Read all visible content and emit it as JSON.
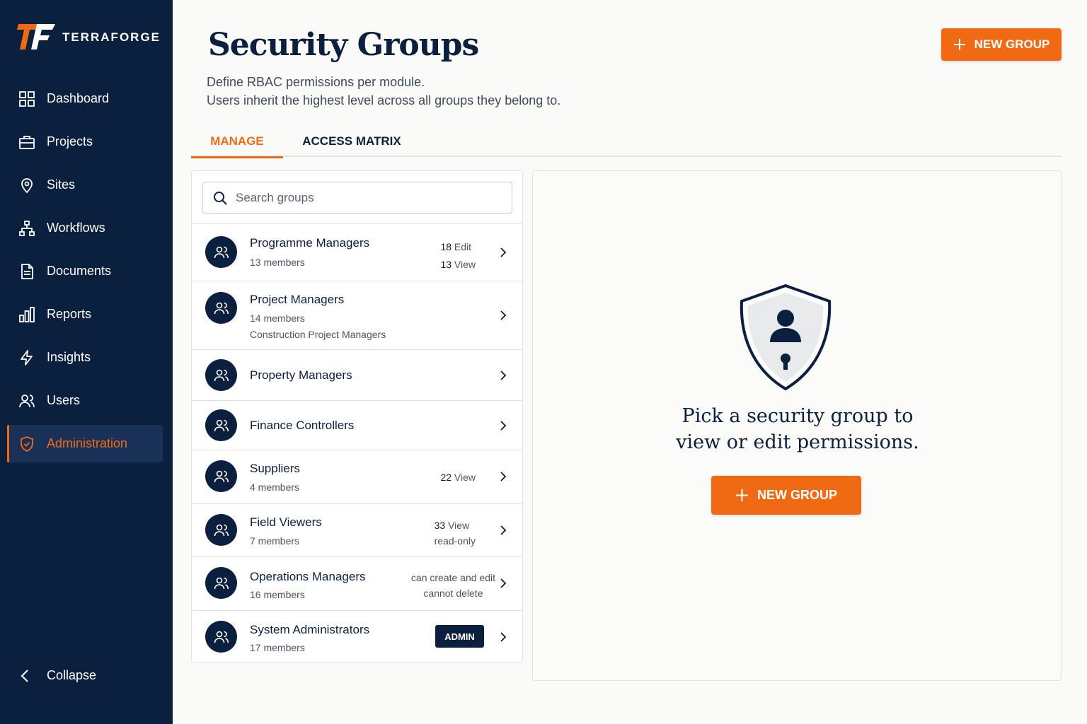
{
  "brand": {
    "name": "TERRAFORGE"
  },
  "sidebar": {
    "items": [
      {
        "label": "Dashboard",
        "icon": "dashboard-icon"
      },
      {
        "label": "Projects",
        "icon": "briefcase-icon"
      },
      {
        "label": "Sites",
        "icon": "map-pin-icon"
      },
      {
        "label": "Workflows",
        "icon": "workflow-icon"
      },
      {
        "label": "Documents",
        "icon": "document-icon"
      },
      {
        "label": "Reports",
        "icon": "bar-chart-icon"
      },
      {
        "label": "Insights",
        "icon": "lightning-icon"
      },
      {
        "label": "Users",
        "icon": "users-icon"
      },
      {
        "label": "Administration",
        "icon": "shield-icon",
        "active": true
      }
    ],
    "collapse_label": "Collapse"
  },
  "header": {
    "title": "Security Groups",
    "description_line1": "Define RBAC permissions per module.",
    "description_line2": "Users inherit the highest level across all groups they belong to.",
    "new_group_label": "NEW GROUP"
  },
  "tabs": [
    {
      "label": "MANAGE",
      "active": true
    },
    {
      "label": "ACCESS MATRIX",
      "active": false
    }
  ],
  "search": {
    "placeholder": "Search groups",
    "value": ""
  },
  "groups": [
    {
      "name": "Programme Managers",
      "members": "13 members",
      "right_line1_num": "18",
      "right_line1_text": " Edit",
      "right_line2_num": "13",
      "right_line2_text": " View"
    },
    {
      "name": "Project Managers",
      "members": "14 members",
      "description": "Construction Project Managers"
    },
    {
      "name": "Property Managers"
    },
    {
      "name": "Finance Controllers"
    },
    {
      "name": "Suppliers",
      "members": "4 members",
      "right_line1_num": "22",
      "right_line1_text": " View"
    },
    {
      "name": "Field Viewers",
      "members": "7 members",
      "right_line1_num": "33",
      "right_line1_text": " View",
      "right_line2_text": "read-only"
    },
    {
      "name": "Operations Managers",
      "members": "16 members",
      "right_line1_text": "can create and edit",
      "right_line2_text": "cannot delete"
    },
    {
      "name": "System Administrators",
      "members": "17 members",
      "badge": "ADMIN"
    }
  ],
  "detail": {
    "empty_line1": "Pick a security group to",
    "empty_line2": "view or edit permissions.",
    "new_group_label": "NEW GROUP"
  },
  "colors": {
    "navy": "#0b1f3f",
    "accent": "#f06a14",
    "active_nav_bg": "#1a3157"
  }
}
